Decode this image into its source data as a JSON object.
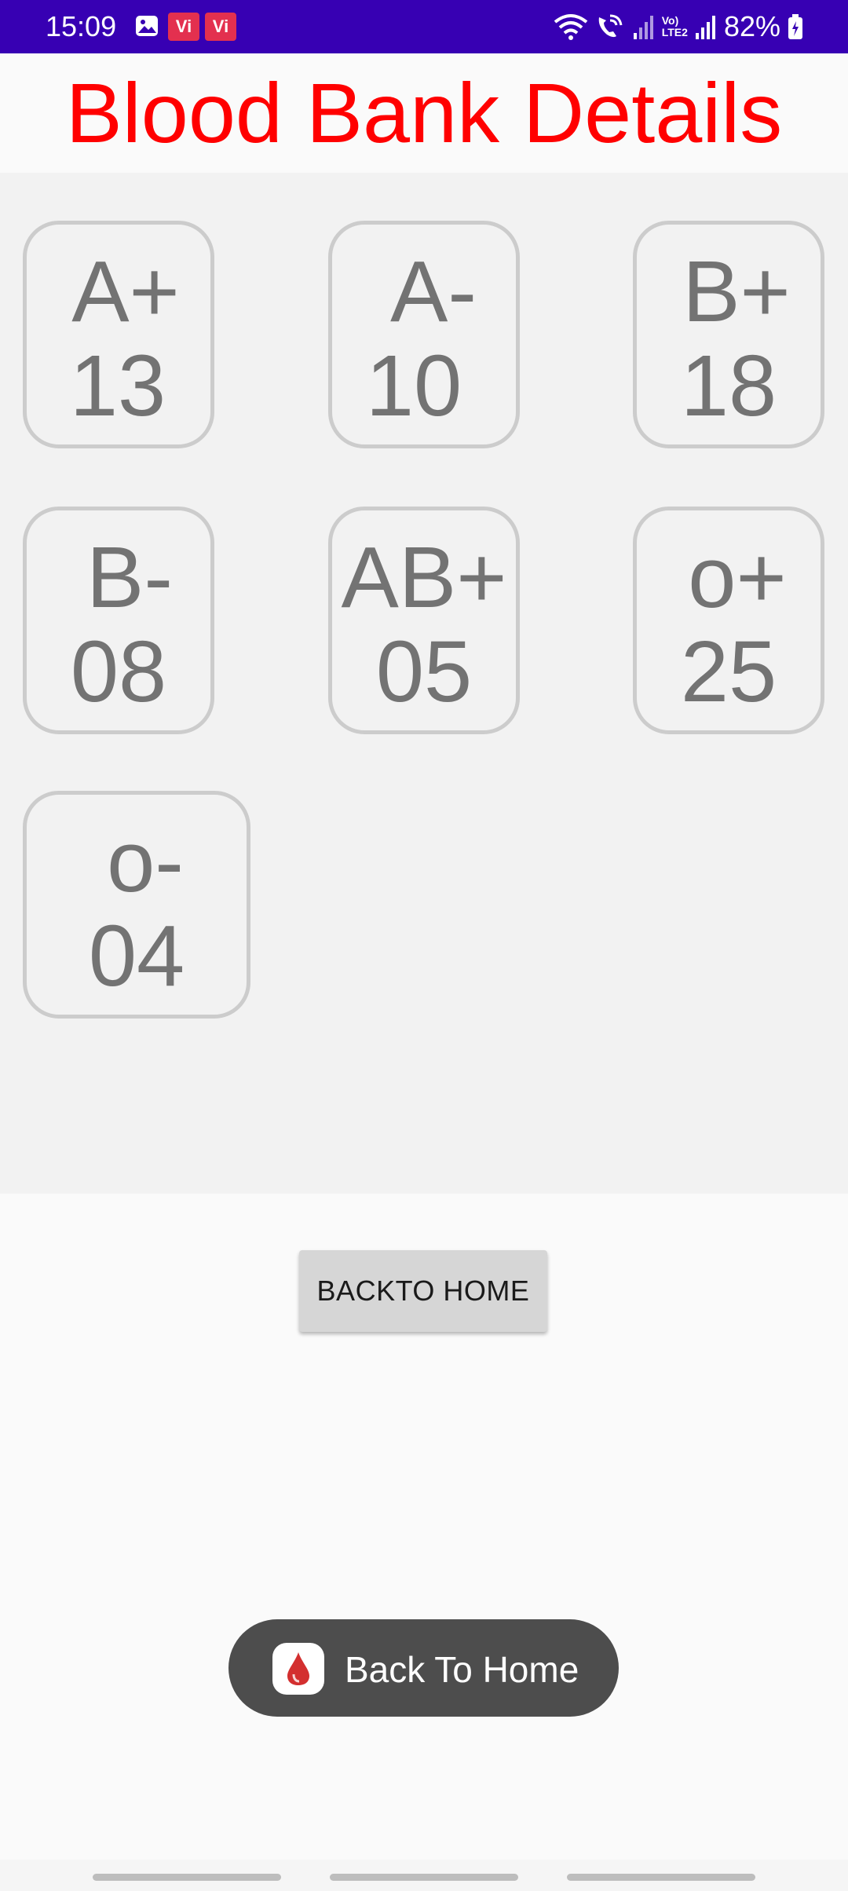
{
  "status_bar": {
    "time": "15:09",
    "battery": "82%",
    "carrier_badge_1": "Vi",
    "carrier_badge_2": "Vi",
    "lte_label_top": "Vo)",
    "lte_label_bottom": "LTE2",
    "icons": [
      "gallery-icon",
      "wifi-icon",
      "wifi-calling-icon",
      "signal-icon",
      "signal-icon",
      "battery-icon"
    ]
  },
  "page": {
    "title": "Blood Bank Details"
  },
  "blood_groups": [
    {
      "type": "A+",
      "count": "13"
    },
    {
      "type": "A-",
      "count": "10"
    },
    {
      "type": "B+",
      "count": "18"
    },
    {
      "type": "B-",
      "count": "08"
    },
    {
      "type": "AB+",
      "count": "05"
    },
    {
      "type": "o+",
      "count": "25"
    },
    {
      "type": "o-",
      "count": "04"
    }
  ],
  "actions": {
    "back_home_button": "BACKTO HOME"
  },
  "toast": {
    "text": "Back To Home",
    "icon": "blood-drop-icon"
  },
  "colors": {
    "status_bar": "#3700b3",
    "title": "#ff0000",
    "card_text": "#737373",
    "card_border": "#cccccc",
    "toast_bg": "#4d4d4d"
  }
}
